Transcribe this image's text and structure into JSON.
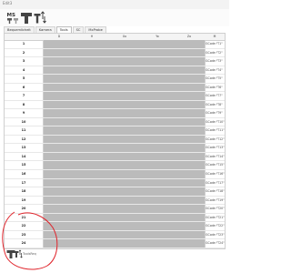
{
  "window": {
    "title": "Edit3"
  },
  "toolbar": {
    "icons": [
      {
        "name": "mode-select-icon"
      },
      {
        "name": "tool-icon"
      },
      {
        "name": "tool-swap-icon"
      }
    ]
  },
  "tabs": [
    {
      "label": "Bequemlicheit"
    },
    {
      "label": "Kamera"
    },
    {
      "label": "Tools",
      "active": true
    },
    {
      "label": "SC"
    },
    {
      "label": "MxProbe"
    }
  ],
  "table": {
    "headers": [
      "",
      "D",
      "H",
      "Xo",
      "Yo",
      "Zo",
      "M"
    ],
    "rows": [
      {
        "num": "1",
        "cmd": "GCode:\"T1\""
      },
      {
        "num": "2",
        "cmd": "GCode:\"T2\""
      },
      {
        "num": "3",
        "cmd": "GCode:\"T3\""
      },
      {
        "num": "4",
        "cmd": "GCode:\"T4\""
      },
      {
        "num": "5",
        "cmd": "GCode:\"T5\""
      },
      {
        "num": "6",
        "cmd": "GCode:\"T6\""
      },
      {
        "num": "7",
        "cmd": "GCode:\"T7\""
      },
      {
        "num": "8",
        "cmd": "GCode:\"T8\""
      },
      {
        "num": "9",
        "cmd": "GCode:\"T9\""
      },
      {
        "num": "10",
        "cmd": "GCode:\"T10\""
      },
      {
        "num": "11",
        "cmd": "GCode:\"T11\""
      },
      {
        "num": "12",
        "cmd": "GCode:\"T12\""
      },
      {
        "num": "13",
        "cmd": "GCode:\"T13\""
      },
      {
        "num": "14",
        "cmd": "GCode:\"T14\""
      },
      {
        "num": "15",
        "cmd": "GCode:\"T15\""
      },
      {
        "num": "16",
        "cmd": "GCode:\"T16\""
      },
      {
        "num": "17",
        "cmd": "GCode:\"T17\""
      },
      {
        "num": "18",
        "cmd": "GCode:\"T18\""
      },
      {
        "num": "19",
        "cmd": "GCode:\"T19\""
      },
      {
        "num": "20",
        "cmd": "GCode:\"T20\""
      },
      {
        "num": "21",
        "cmd": "GCode:\"T21\""
      },
      {
        "num": "22",
        "cmd": "GCode:\"T22\""
      },
      {
        "num": "23",
        "cmd": "GCode:\"T23\""
      },
      {
        "num": "24",
        "cmd": "GCode:\"T24\""
      }
    ]
  },
  "bottom": {
    "label": "ToolsReq"
  },
  "colors": {
    "disabled_area": "#bbbbbb",
    "annotation": "#e0242b"
  }
}
